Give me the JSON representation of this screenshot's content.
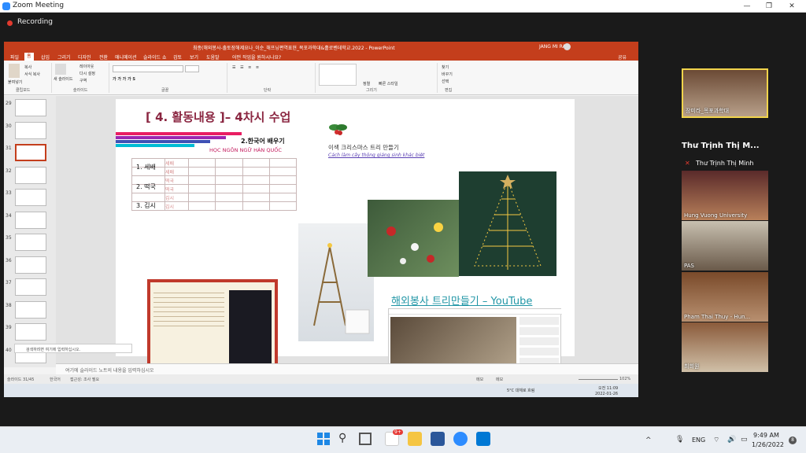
{
  "zoom": {
    "window_title": "Zoom Meeting",
    "recording_label": "Recording",
    "min": "—",
    "max": "❐",
    "close": "✕"
  },
  "ppt": {
    "title": "최종(해외봉사-출토장해제요나_이순_해프닝편역표현_목포과학대&홀로벤데학교.2022 - PowerPoint",
    "user": "JANG MI RA",
    "tabs": [
      "파일",
      "홈",
      "삽입",
      "그리기",
      "디자인",
      "전환",
      "애니메이션",
      "슬라이드 쇼",
      "검토",
      "보기",
      "도움말",
      "어떤 작업을 원하시나요?"
    ],
    "share_label": "공유",
    "ribbon_groups": [
      "클립보드",
      "슬라이드",
      "글꼴",
      "단락",
      "그리기",
      "편집"
    ],
    "ribbon_buttons": [
      "붙여넣기",
      "복사",
      "서식 복사",
      "새 슬라이드",
      "레이아웃",
      "다시 설정",
      "구역",
      "정렬",
      "빠른 스타일",
      "찾기",
      "바꾸기",
      "선택"
    ],
    "thumb_numbers": [
      "29",
      "30",
      "31",
      "32",
      "33",
      "34",
      "35",
      "36",
      "37",
      "38",
      "39",
      "40"
    ],
    "selected_thumb": "31",
    "notes_placeholder": "여기에 슬라이드 노트의 내용을 입력하십시오",
    "status_left": "슬라이드 31/45",
    "status_lang": "한국어",
    "status_access": "접근성: 조사 필요",
    "status_notes": "메모",
    "status_comments": "메모",
    "zoom_level": "102%",
    "search_placeholder": "검색하려면 여기에 입력하십시오.",
    "weather": "5°C 대체로 흐림",
    "task_time": "오전 11:09",
    "task_date": "2022-01-26"
  },
  "slide": {
    "title": "[ 4. 활동내용 ]– 4차시 수업",
    "kor_learn": "2.한국어 배우기",
    "vn_learn": "HỌC NGÔN NGỮ HÀN QUỐC",
    "vocab": [
      {
        "label": "1. 세배",
        "a": "세배",
        "b": "세배"
      },
      {
        "label": "2. 떡국",
        "a": "떡국",
        "b": "떡국"
      },
      {
        "label": "3. 김시",
        "a": "김시",
        "b": "김시"
      }
    ],
    "xmas_ko": "이색 크리스마스 트리 만들기",
    "xmas_vi": "Cách làm cây thông giáng sinh khác biệt",
    "youtube_link": "해외봉사 트리만들기 – YouTube"
  },
  "participants": [
    {
      "name": "장미라_목포과학대"
    },
    {
      "name": "Thư Trịnh Thị M..."
    },
    {
      "name": "Thư Trịnh Thị Minh"
    },
    {
      "name": "Hung Vuong University"
    },
    {
      "name": "PAS"
    },
    {
      "name": "Pham Thai Thuy - Hun..."
    },
    {
      "name": "최희원"
    }
  ],
  "taskbar": {
    "lang": "ENG",
    "time": "9:49 AM",
    "date": "1/26/2022",
    "notif_count": "8",
    "app_badge": "9+"
  },
  "colors": {
    "ppt_accent": "#c43e1c",
    "slide_title": "#8a2540",
    "zoom_blue": "#2d8cff"
  }
}
